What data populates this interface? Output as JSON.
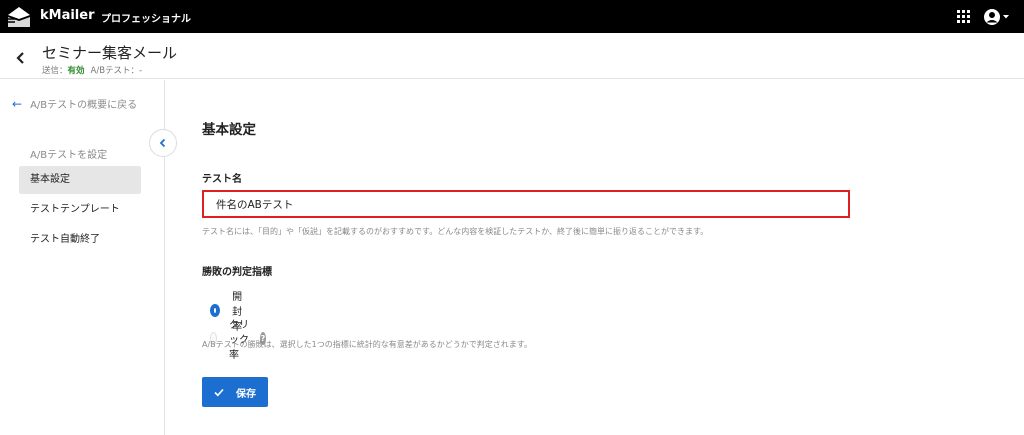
{
  "app": {
    "brand": "kMailer",
    "edition": "プロフェッショナル",
    "icons": [
      "logo-icon",
      "apps-grid-icon",
      "account-icon",
      "chevron-down-icon"
    ]
  },
  "header": {
    "title": "セミナー集客メール",
    "status_label": "送信：",
    "status_value": "有効",
    "ab_label": "A/Bテスト：-"
  },
  "sidebar": {
    "back_link": "A/Bテストの概要に戻る",
    "section_label": "A/Bテストを設定",
    "items": [
      {
        "label": "基本設定",
        "active": true
      },
      {
        "label": "テストテンプレート",
        "active": false
      },
      {
        "label": "テスト自動終了",
        "active": false
      }
    ]
  },
  "main": {
    "section_title": "基本設定",
    "test_name": {
      "label": "テスト名",
      "value": "件名のABテスト",
      "help": "テスト名には、「目的」や「仮説」を記載するのがおすすめです。どんな内容を検証したテストか、終了後に簡単に振り返ることができます。"
    },
    "metric": {
      "label": "勝敗の判定指標",
      "options": [
        {
          "label": "開封率",
          "selected": true
        },
        {
          "label": "クリック率",
          "selected": false
        }
      ],
      "help": "A/Bテストの勝敗は、選択した1つの指標に統計的な有意差があるかどうかで判定されます。"
    },
    "save_label": "保存"
  },
  "colors": {
    "accent": "#1c6fd1",
    "highlight": "#e02020",
    "active_status": "#2e8b2e"
  }
}
